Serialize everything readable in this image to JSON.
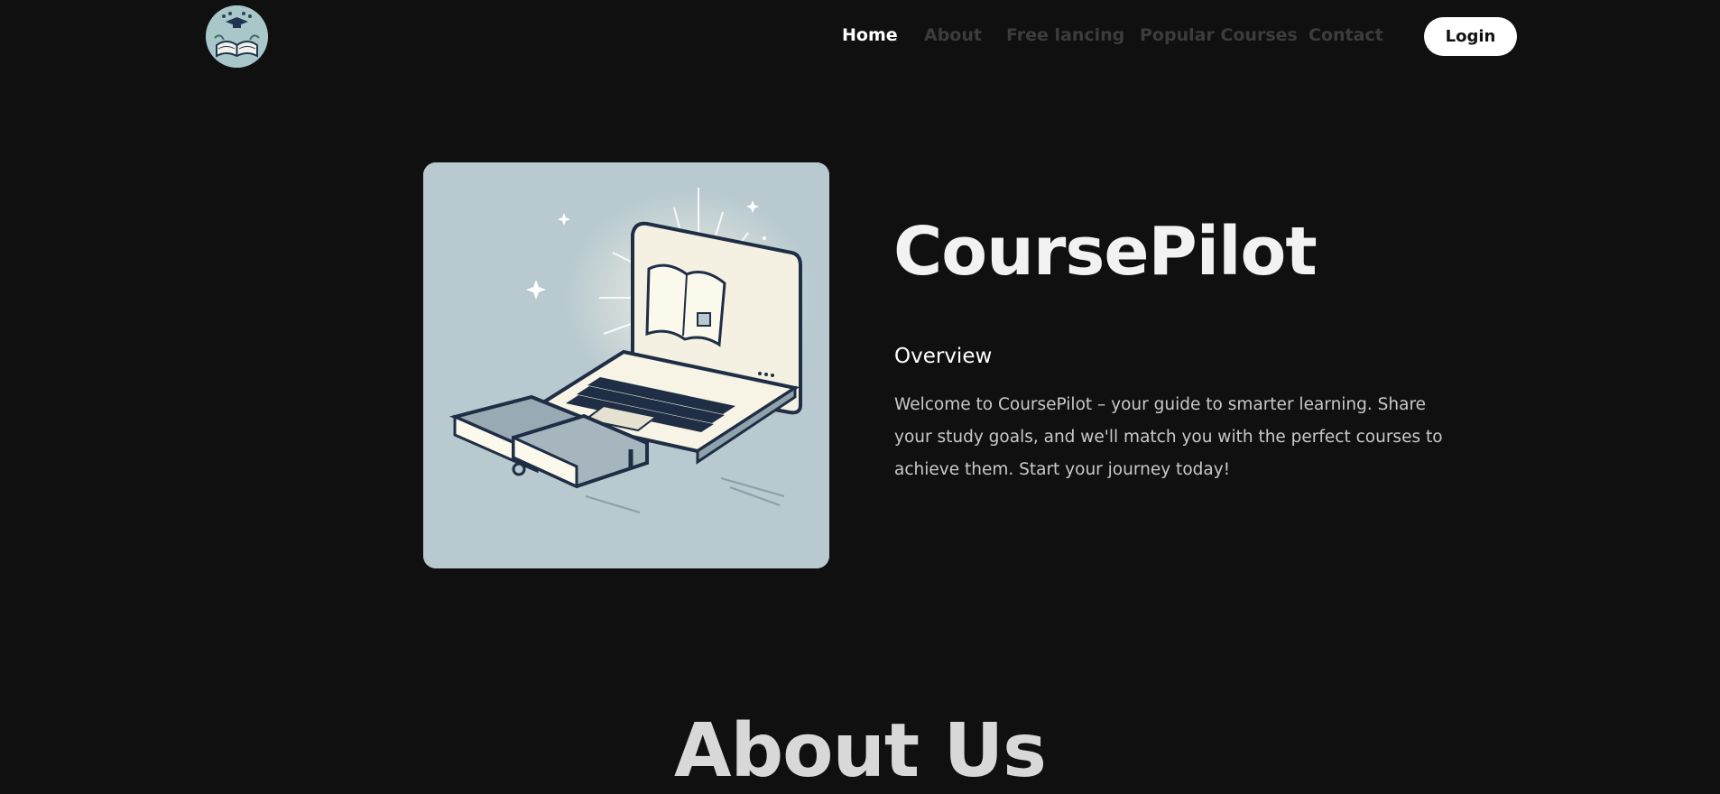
{
  "header": {
    "logo_name": "book-graduation-logo",
    "nav": [
      {
        "label": "Home",
        "active": true
      },
      {
        "label": "About",
        "active": false
      },
      {
        "label": "Free lancing",
        "active": false
      },
      {
        "label": "Popular Courses",
        "active": false
      },
      {
        "label": "Contact",
        "active": false
      }
    ],
    "login_label": "Login"
  },
  "hero": {
    "image_name": "laptop-and-books-illustration",
    "title": "CoursePilot",
    "subtitle": "Overview",
    "description": "Welcome to CoursePilot – your guide to smarter learning. Share your study goals, and we'll match you with the perfect courses to achieve them. Start your journey today!"
  },
  "about": {
    "heading": "About Us"
  },
  "colors": {
    "background": "#101010",
    "nav_inactive": "#3c3c3c",
    "nav_active": "#ffffff",
    "button_bg": "#ffffff",
    "illustration_bg": "#b8c9cf"
  }
}
